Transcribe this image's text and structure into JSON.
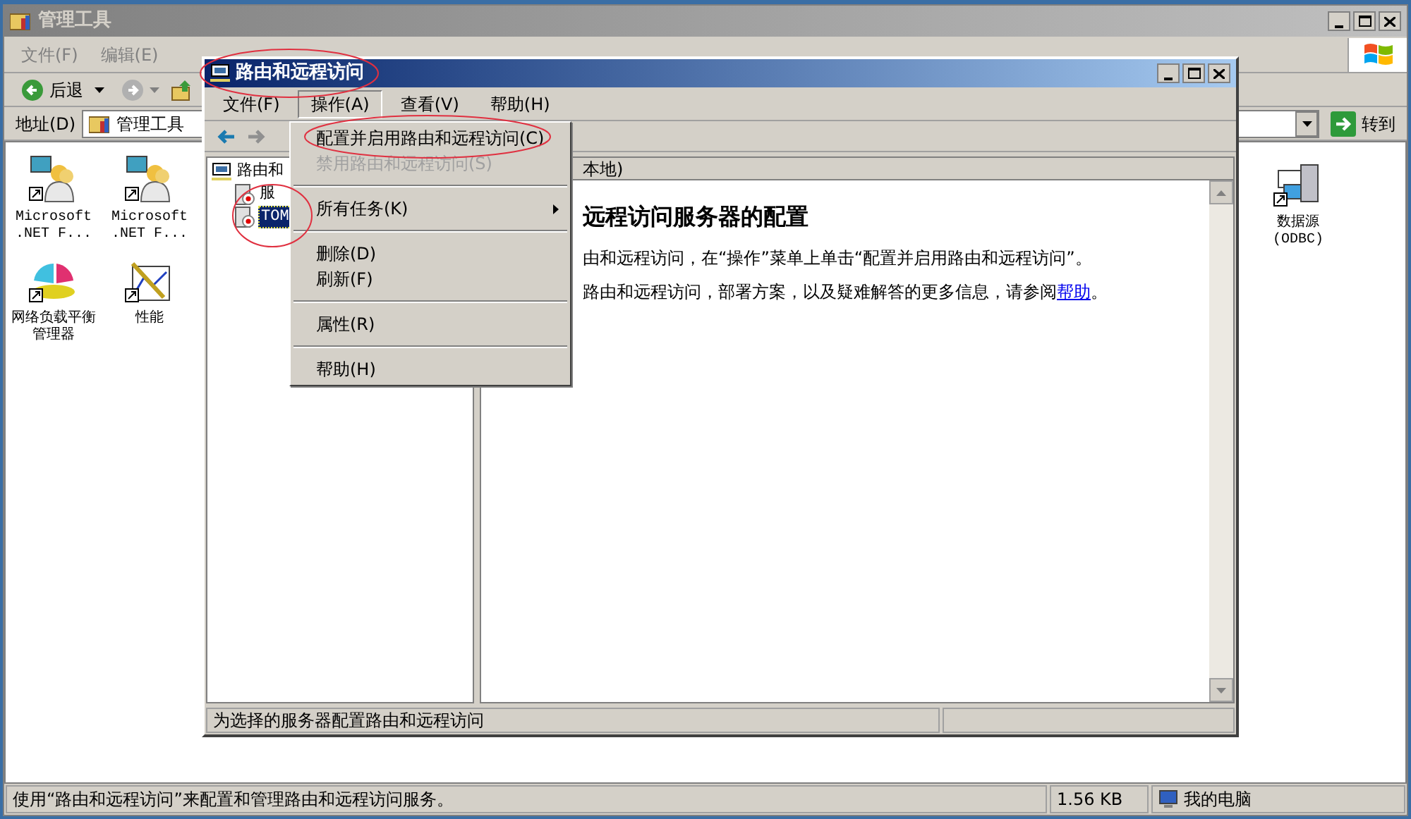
{
  "explorer": {
    "title": "管理工具",
    "menu": [
      {
        "label": "文件(F)"
      },
      {
        "label": "编辑(E)"
      }
    ],
    "back_label": "后退",
    "address": {
      "label": "地址(D)",
      "value": "管理工具",
      "go": "转到"
    },
    "icons": [
      {
        "label": "Microsoft .NET F...",
        "kind": "users"
      },
      {
        "label": "Microsoft .NET F...",
        "kind": "users"
      },
      {
        "label": "网络负载平衡管理器",
        "kind": "pie"
      },
      {
        "label": "性能",
        "kind": "chart"
      }
    ],
    "right_icons": [
      {
        "label": "数据源 (ODBC)",
        "kind": "database"
      }
    ],
    "status_bar": [
      "使用“路由和远程访问”来配置和管理路由和远程访问服务。",
      "1.56 KB",
      "我的电脑"
    ]
  },
  "mmc": {
    "title": "路由和远程访问",
    "menu": [
      {
        "label": "文件(F)",
        "selected": false
      },
      {
        "label": "操作(A)",
        "selected": true
      },
      {
        "label": "查看(V)",
        "selected": false
      },
      {
        "label": "帮助(H)",
        "selected": false
      }
    ],
    "tree": [
      {
        "label": "路由和",
        "selected": false,
        "children": [
          {
            "label": "服",
            "selected": false
          },
          {
            "label": "TOM",
            "selected": true
          }
        ]
      }
    ],
    "header": "本地)",
    "heading": "远程访问服务器的配置",
    "paragraphs": [
      {
        "text": "由和远程访问，在“操作”菜单上单击“配置并启用路由和远程访问”。"
      },
      {
        "text": "路由和远程访问，部署方案，以及疑难解答的更多信息，请参阅",
        "link": "帮助",
        "after": "。"
      }
    ],
    "status_bar": "为选择的服务器配置路由和远程访问"
  },
  "context_menu": [
    {
      "kind": "item",
      "label": "配置并启用路由和远程访问(C)",
      "disabled": false
    },
    {
      "kind": "item",
      "label": "禁用路由和远程访问(S)",
      "disabled": true
    },
    {
      "kind": "separator"
    },
    {
      "kind": "submenu",
      "label": "所有任务(K)",
      "disabled": false
    },
    {
      "kind": "separator"
    },
    {
      "kind": "item",
      "label": "删除(D)",
      "disabled": false
    },
    {
      "kind": "item",
      "label": "刷新(F)",
      "disabled": false
    },
    {
      "kind": "separator"
    },
    {
      "kind": "item",
      "label": "属性(R)",
      "disabled": false
    },
    {
      "kind": "separator"
    },
    {
      "kind": "item",
      "label": "帮助(H)",
      "disabled": false
    }
  ]
}
